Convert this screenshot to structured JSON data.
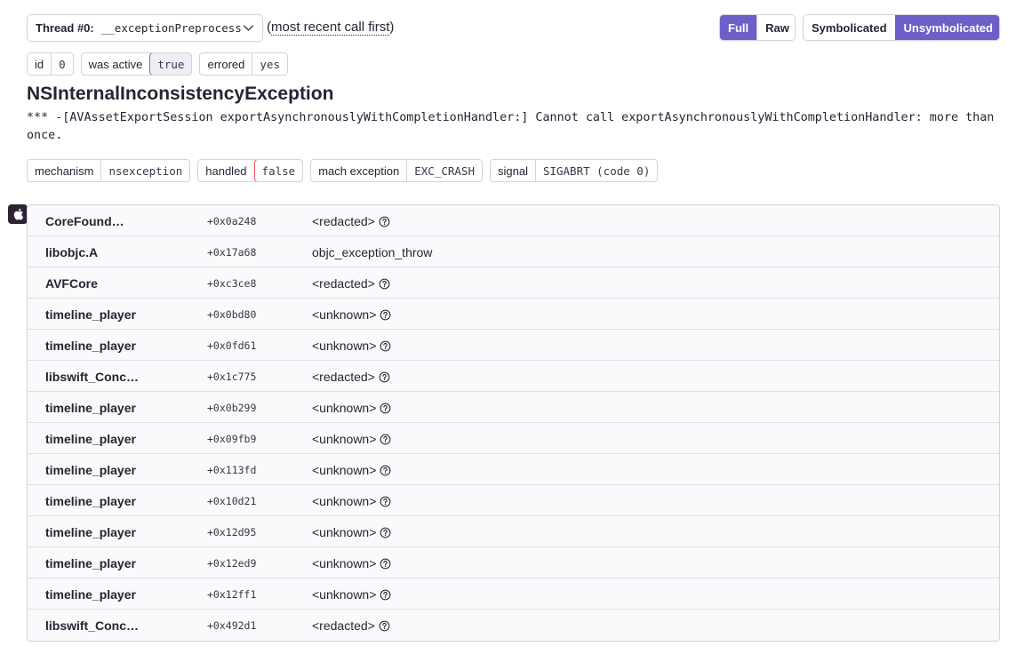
{
  "thread": {
    "label": "Thread #0:",
    "value": "__exceptionPreprocess",
    "order_open": "(",
    "order_text": "most recent call first",
    "order_close": ")"
  },
  "view_toggle": {
    "full": "Full",
    "raw": "Raw",
    "active": "Full"
  },
  "sym_toggle": {
    "symbolicated": "Symbolicated",
    "unsymbolicated": "Unsymbolicated",
    "active": "Unsymbolicated"
  },
  "thread_tags": [
    {
      "key": "id",
      "value": "0"
    },
    {
      "key": "was active",
      "value": "true"
    },
    {
      "key": "errored",
      "value": "yes"
    }
  ],
  "exception": {
    "type": "NSInternalInconsistencyException",
    "message": "*** -[AVAssetExportSession exportAsynchronouslyWithCompletionHandler:] Cannot call exportAsynchronouslyWithCompletionHandler: more than once."
  },
  "mechanism_tags": [
    {
      "key": "mechanism",
      "value": "nsexception"
    },
    {
      "key": "handled",
      "value": "false"
    },
    {
      "key": "mach exception",
      "value": "EXC_CRASH"
    },
    {
      "key": "signal",
      "value": "SIGABRT (code 0)"
    }
  ],
  "platform_icon": "apple-icon",
  "frames": [
    {
      "package": "CoreFound…",
      "address": "+0x0a248",
      "function": "<redacted>",
      "help": true
    },
    {
      "package": "libobjc.A",
      "address": "+0x17a68",
      "function": "objc_exception_throw",
      "help": false
    },
    {
      "package": "AVFCore",
      "address": "+0xc3ce8",
      "function": "<redacted>",
      "help": true
    },
    {
      "package": "timeline_player",
      "address": "+0x0bd80",
      "function": "<unknown>",
      "help": true
    },
    {
      "package": "timeline_player",
      "address": "+0x0fd61",
      "function": "<unknown>",
      "help": true
    },
    {
      "package": "libswift_Conc…",
      "address": "+0x1c775",
      "function": "<redacted>",
      "help": true
    },
    {
      "package": "timeline_player",
      "address": "+0x0b299",
      "function": "<unknown>",
      "help": true
    },
    {
      "package": "timeline_player",
      "address": "+0x09fb9",
      "function": "<unknown>",
      "help": true
    },
    {
      "package": "timeline_player",
      "address": "+0x113fd",
      "function": "<unknown>",
      "help": true
    },
    {
      "package": "timeline_player",
      "address": "+0x10d21",
      "function": "<unknown>",
      "help": true
    },
    {
      "package": "timeline_player",
      "address": "+0x12d95",
      "function": "<unknown>",
      "help": true
    },
    {
      "package": "timeline_player",
      "address": "+0x12ed9",
      "function": "<unknown>",
      "help": true
    },
    {
      "package": "timeline_player",
      "address": "+0x12ff1",
      "function": "<unknown>",
      "help": true
    },
    {
      "package": "libswift_Conc…",
      "address": "+0x492d1",
      "function": "<redacted>",
      "help": true
    }
  ],
  "colors": {
    "accent": "#6c5fc7",
    "error_border": "#f55459",
    "text": "#2b2233",
    "border": "#d6d3dc"
  }
}
